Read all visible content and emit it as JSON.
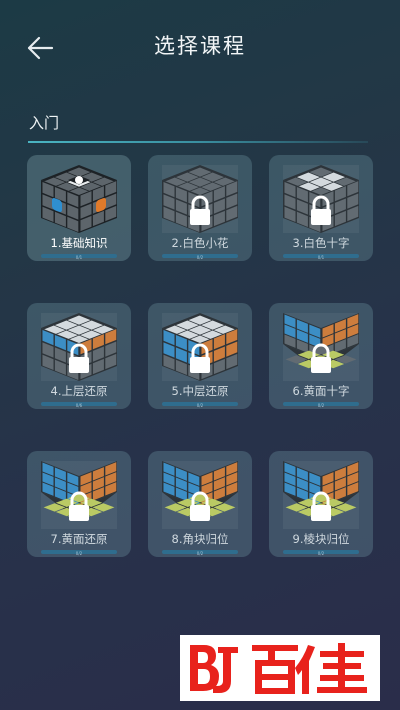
{
  "header": {
    "title": "选择课程",
    "back_icon": "arrow-left-icon"
  },
  "section": {
    "title": "入门"
  },
  "courses": [
    {
      "label": "1.基础知识",
      "progress_text": "0/1",
      "progress": 0.0,
      "locked": false
    },
    {
      "label": "2.白色小花",
      "progress_text": "0/2",
      "progress": 0.0,
      "locked": true
    },
    {
      "label": "3.白色十字",
      "progress_text": "0/1",
      "progress": 0.0,
      "locked": true
    },
    {
      "label": "4.上层还原",
      "progress_text": "0/6",
      "progress": 0.0,
      "locked": true
    },
    {
      "label": "5.中层还原",
      "progress_text": "0/2",
      "progress": 0.0,
      "locked": true
    },
    {
      "label": "6.黄面十字",
      "progress_text": "0/2",
      "progress": 0.0,
      "locked": true
    },
    {
      "label": "7.黄面还原",
      "progress_text": "0/2",
      "progress": 0.0,
      "locked": true
    },
    {
      "label": "8.角块归位",
      "progress_text": "0/2",
      "progress": 0.0,
      "locked": true
    },
    {
      "label": "9.棱块归位",
      "progress_text": "0/2",
      "progress": 0.0,
      "locked": true
    }
  ],
  "colors": {
    "accent_line": "#4ab4c2",
    "progress_track": "#2f6d8e",
    "logo_red": "#e8221c"
  }
}
